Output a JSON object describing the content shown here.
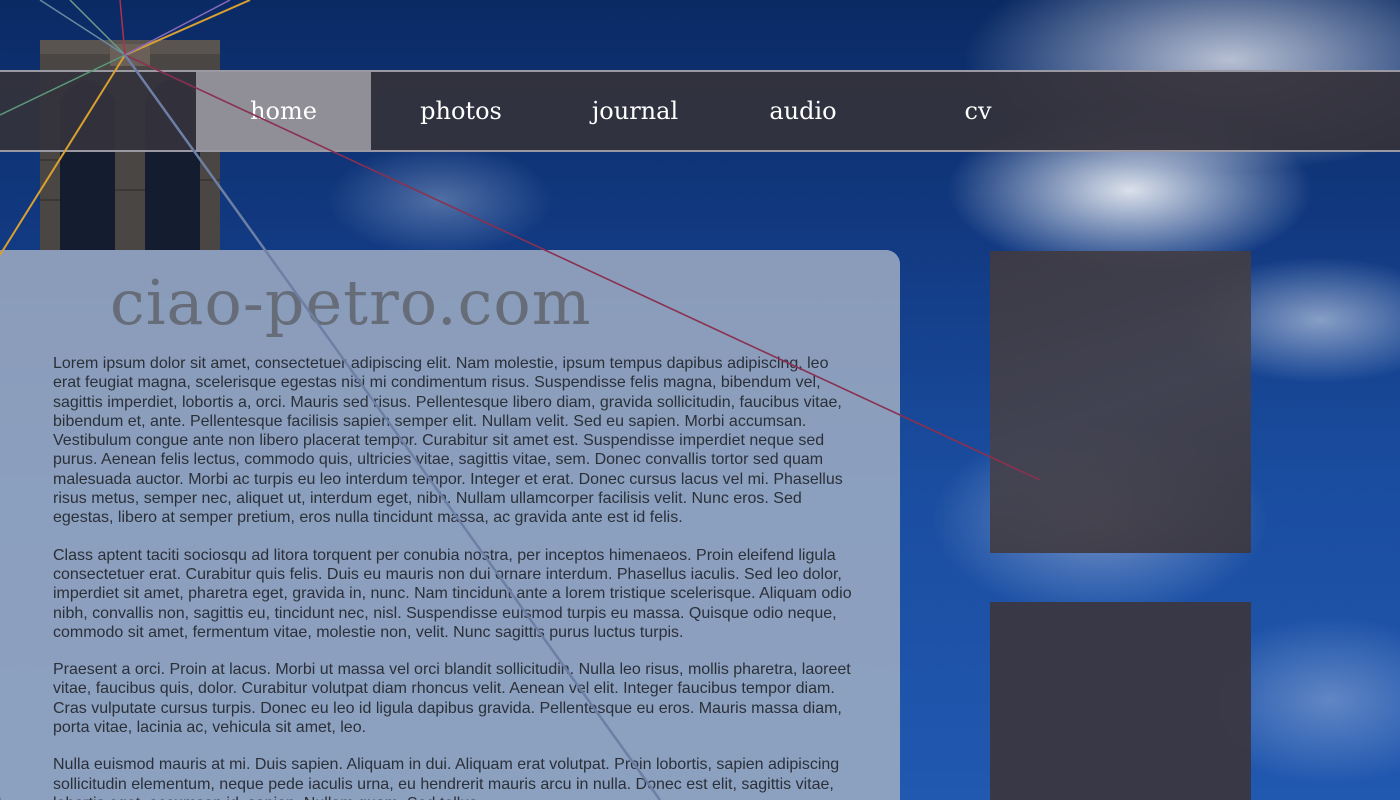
{
  "site": {
    "title": "ciao-petro.com"
  },
  "nav": {
    "items": [
      {
        "label": "home",
        "active": true
      },
      {
        "label": "photos",
        "active": false
      },
      {
        "label": "journal",
        "active": false
      },
      {
        "label": "audio",
        "active": false
      },
      {
        "label": "cv",
        "active": false
      }
    ]
  },
  "content": {
    "paragraphs": [
      "Lorem ipsum dolor sit amet, consectetuer adipiscing elit. Nam molestie, ipsum tempus dapibus adipiscing, leo erat feugiat magna, scelerisque egestas nisi mi condimentum risus. Suspendisse felis magna, bibendum vel, sagittis imperdiet, lobortis a, orci. Mauris sed risus. Pellentesque libero diam, gravida sollicitudin, faucibus vitae, bibendum et, ante. Pellentesque facilisis sapien semper elit. Nullam velit. Sed eu sapien. Morbi accumsan. Vestibulum congue ante non libero placerat tempor. Curabitur sit amet est. Suspendisse imperdiet neque sed purus. Aenean felis lectus, commodo quis, ultricies vitae, sagittis vitae, sem. Donec convallis tortor sed quam malesuada auctor. Morbi ac turpis eu leo interdum tempor. Integer et erat. Donec cursus lacus vel mi. Phasellus risus metus, semper nec, aliquet ut, interdum eget, nibh. Nullam ullamcorper facilisis velit. Nunc eros. Sed egestas, libero at semper pretium, eros nulla tincidunt massa, ac gravida ante est id felis.",
      "Class aptent taciti sociosqu ad litora torquent per conubia nostra, per inceptos himenaeos. Proin eleifend ligula consectetuer erat. Curabitur quis felis. Duis eu mauris non dui ornare interdum. Phasellus iaculis. Sed leo dolor, imperdiet sit amet, pharetra eget, gravida in, nunc. Nam tincidunt ante a lorem tristique scelerisque. Aliquam odio nibh, convallis non, sagittis eu, tincidunt nec, nisl. Suspendisse euismod turpis eu massa. Quisque odio neque, commodo sit amet, fermentum vitae, molestie non, velit. Nunc sagittis purus luctus turpis.",
      "Praesent a orci. Proin at lacus. Morbi ut massa vel orci blandit sollicitudin. Nulla leo risus, mollis pharetra, laoreet vitae, faucibus quis, dolor. Curabitur volutpat diam rhoncus velit. Aenean vel elit. Integer faucibus tempor diam. Cras vulputate cursus turpis. Donec eu leo id ligula dapibus gravida. Pellentesque eu eros. Mauris massa diam, porta vitae, lacinia ac, vehicula sit amet, leo.",
      "Nulla euismod mauris at mi. Duis sapien. Aliquam in dui. Aliquam erat volutpat. Proin lobortis, sapien adipiscing sollicitudin elementum, neque pede iaculis urna, eu hendrerit mauris arcu in nulla. Donec est elit, sagittis vitae, lobortis eget, accumsan id, sapien. Nullam quam. Sed tellus."
    ]
  },
  "colors": {
    "nav_bg": "#34323c",
    "nav_active_bg": "#96949b",
    "panel_bg": "#9eacc2",
    "title_color": "#666d79",
    "text_color": "#2b3038",
    "sidebar_box": "#3a363e"
  }
}
